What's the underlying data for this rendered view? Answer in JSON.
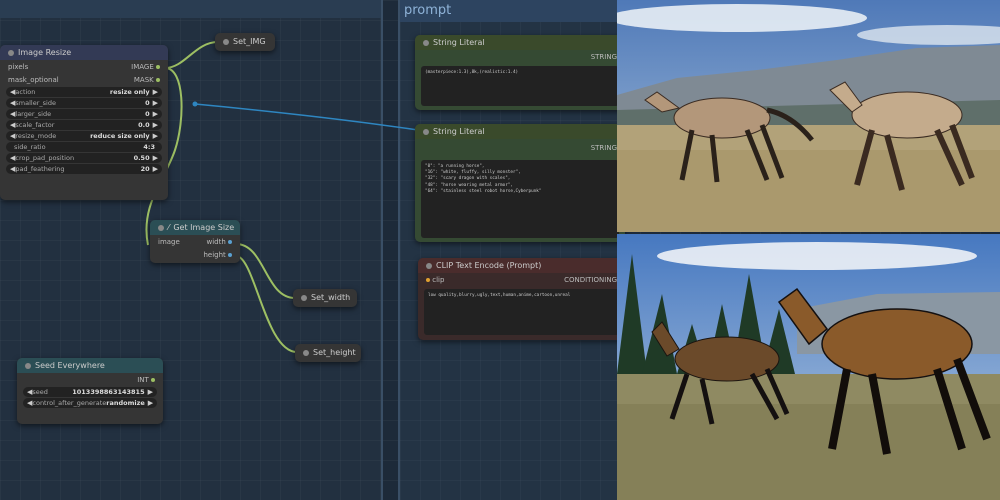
{
  "groups": {
    "prompt_title": "prompt"
  },
  "nodes": {
    "image_resize": {
      "title": "Image Resize",
      "inputs": [
        "pixels",
        "mask_optional"
      ],
      "outputs": [
        "IMAGE",
        "MASK"
      ],
      "widgets": [
        {
          "label": "action",
          "value": "resize only"
        },
        {
          "label": "smaller_side",
          "value": "0"
        },
        {
          "label": "larger_side",
          "value": "0"
        },
        {
          "label": "scale_factor",
          "value": "0.0"
        },
        {
          "label": "resize_mode",
          "value": "reduce size only"
        },
        {
          "label": "side_ratio",
          "value": "4:3"
        },
        {
          "label": "crop_pad_position",
          "value": "0.50"
        },
        {
          "label": "pad_feathering",
          "value": "20"
        }
      ]
    },
    "set_img": {
      "title": "Set_IMG"
    },
    "get_image_size": {
      "title": "Get Image Size",
      "input": "image",
      "outputs": [
        "width",
        "height"
      ]
    },
    "set_width": {
      "title": "Set_width"
    },
    "set_height": {
      "title": "Set_height"
    },
    "seed_everywhere": {
      "title": "Seed Everywhere",
      "output": "INT",
      "widgets": [
        {
          "label": "seed",
          "value": "1013398863143815"
        },
        {
          "label": "control_after_generate",
          "value": "randomize"
        }
      ]
    },
    "string_literal_1": {
      "title": "String Literal",
      "output": "STRING",
      "text": "(masterpiece:1.3),8k,(realistic:1.4)"
    },
    "string_literal_2": {
      "title": "String Literal",
      "output": "STRING",
      "text": "\"0\": \"a running horse\",\n\"16\": \"white, fluffy, silly monster\",\n\"32\": \"scary dragon with scales\",\n\"48\": \"horse wearing metal armor\",\n\"64\": \"stainless steel robot horse,Cyberpunk\""
    },
    "clip_text_encode": {
      "title": "CLIP Text Encode (Prompt)",
      "input": "clip",
      "output": "CONDITIONING",
      "text": "low quality,blurry,ugly,text,human,anime,cartoon,unreal"
    }
  },
  "colors": {
    "canvas": "#1d2a39",
    "node_body": "#353535",
    "node_title_blue": "#333a55",
    "node_title_teal": "#2b4e55",
    "node_title_green": "#3a4a2b",
    "node_body_green": "#354a33",
    "node_title_red": "#4a2c2c",
    "node_body_red": "#3a2a2a",
    "wire_image": "#9dbf63",
    "wire_string": "#2e86c1"
  }
}
